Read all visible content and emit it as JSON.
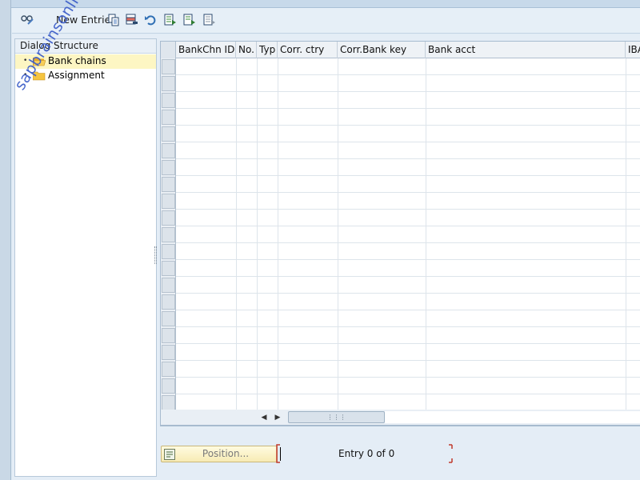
{
  "toolbar": {
    "new_entries_label": "New Entries",
    "icons": [
      "display-change-icon",
      "copy-as-icon",
      "delete-icon",
      "undo-change-icon",
      "select-all-icon",
      "select-block-icon",
      "deselect-all-icon"
    ]
  },
  "dialog_structure": {
    "title": "Dialog Structure",
    "items": [
      {
        "label": "Bank chains",
        "selected": true
      },
      {
        "label": "Assignment",
        "selected": false
      }
    ]
  },
  "watermark": "sapbrainsonline.com",
  "table": {
    "columns": [
      "BankChn ID",
      "No.",
      "Typ",
      "Corr. ctry",
      "Corr.Bank key",
      "Bank acct",
      "IBA"
    ],
    "row_count": 21
  },
  "footer": {
    "position_label": "Position...",
    "entry_text": "Entry 0 of 0"
  },
  "colors": {
    "selected_item": "#fdf6c3",
    "folder": "#f5c440",
    "bracket": "#c0392b",
    "watermark": "#3e5fc9"
  }
}
